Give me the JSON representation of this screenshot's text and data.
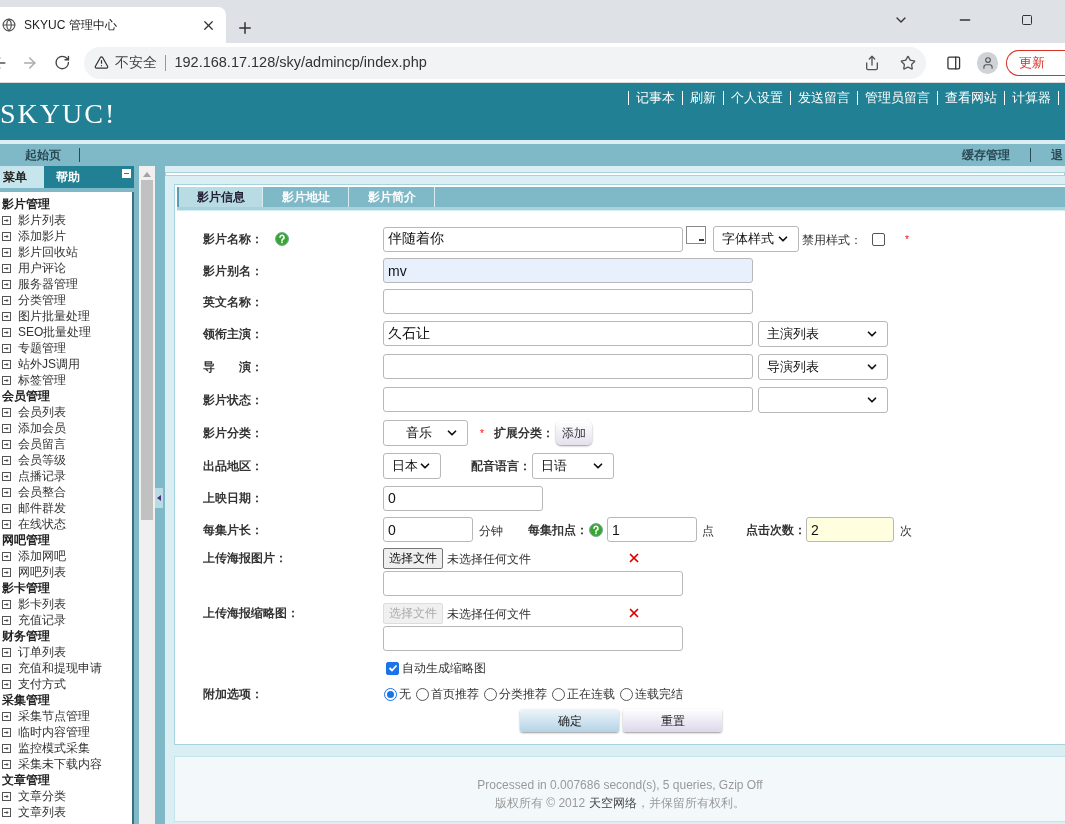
{
  "browser": {
    "tab_title": "SKYUC 管理中心",
    "security": "不安全",
    "url": "192.168.17.128/sky/admincp/index.php",
    "update_button": "更新"
  },
  "header": {
    "logo": "SKYUC!",
    "top_links": [
      "记事本",
      "刷新",
      "个人设置",
      "发送留言",
      "管理员留言",
      "查看网站",
      "计算器"
    ]
  },
  "subnav": {
    "left": [
      "起始页"
    ],
    "right": [
      "缓存管理",
      "退"
    ]
  },
  "sidebar": {
    "tabs": [
      {
        "label": "菜单",
        "selected": true
      },
      {
        "label": "帮助",
        "selected": false
      }
    ],
    "groups": [
      {
        "title": "影片管理",
        "items": [
          "影片列表",
          "添加影片",
          "影片回收站",
          "用户评论",
          "服务器管理",
          "分类管理",
          "图片批量处理",
          "SEO批量处理",
          "专题管理",
          "站外JS调用",
          "标签管理"
        ]
      },
      {
        "title": "会员管理",
        "items": [
          "会员列表",
          "添加会员",
          "会员留言",
          "会员等级",
          "点播记录",
          "会员整合",
          "邮件群发",
          "在线状态"
        ]
      },
      {
        "title": "网吧管理",
        "items": [
          "添加网吧",
          "网吧列表"
        ]
      },
      {
        "title": "影卡管理",
        "items": [
          "影卡列表",
          "充值记录"
        ]
      },
      {
        "title": "财务管理",
        "items": [
          "订单列表",
          "充值和提现申请",
          "支付方式"
        ]
      },
      {
        "title": "采集管理",
        "items": [
          "采集节点管理",
          "临时内容管理",
          "监控模式采集",
          "采集未下载内容"
        ]
      },
      {
        "title": "文章管理",
        "items": [
          "文章分类",
          "文章列表"
        ]
      }
    ]
  },
  "form": {
    "tabs": [
      {
        "label": "影片信息",
        "selected": true
      },
      {
        "label": "影片地址",
        "selected": false
      },
      {
        "label": "影片简介",
        "selected": false
      }
    ],
    "rows": [
      {
        "kind": "title",
        "label": "影片名称：",
        "value": "伴随着你",
        "style_select": "字体样式",
        "disable_label": "禁用样式：",
        "disable_checked": false,
        "required": "*"
      },
      {
        "kind": "text",
        "label": "影片别名：",
        "value": "mv",
        "autofilled": true
      },
      {
        "kind": "text",
        "label": "英文名称：",
        "autofilled": false
      },
      {
        "kind": "text_select",
        "label": "领衔主演：",
        "value": "久石让",
        "select": "主演列表"
      },
      {
        "kind": "text_select",
        "label": "导　　演：",
        "select": "导演列表"
      },
      {
        "kind": "text_select",
        "label": "影片状态："
      },
      {
        "kind": "category",
        "label": "影片分类：",
        "select": "音乐",
        "required": "*",
        "ext_label": "扩展分类：",
        "add_button": "添加"
      },
      {
        "kind": "region",
        "label": "出品地区：",
        "select": "日本",
        "lang_label": "配音语言：",
        "lang_select": "日语"
      },
      {
        "kind": "date",
        "label": "上映日期：",
        "value": "0"
      },
      {
        "kind": "length",
        "label": "每集片长：",
        "value": "0",
        "unit": "分钟",
        "points_label": "每集扣点：",
        "points_value": "1",
        "points_unit": "点",
        "clicks_label": "点击次数：",
        "clicks_value": "2",
        "clicks_unit": "次",
        "clicks_focused": true
      },
      {
        "kind": "file",
        "label": "上传海报图片：",
        "button": "选择文件",
        "disabled": false,
        "status": "未选择任何文件"
      },
      {
        "kind": "file",
        "label": "上传海报缩略图：",
        "button": "选择文件",
        "disabled": true,
        "status": "未选择任何文件"
      },
      {
        "kind": "checkbox",
        "text": "自动生成缩略图",
        "checked": true
      },
      {
        "kind": "radio",
        "label": "附加选项：",
        "options": [
          {
            "label": "无",
            "selected": true
          },
          {
            "label": "首页推荐",
            "selected": false
          },
          {
            "label": "分类推荐",
            "selected": false
          },
          {
            "label": "正在连载",
            "selected": false
          },
          {
            "label": "连载完结",
            "selected": false
          }
        ]
      }
    ],
    "buttons": [
      "确定",
      "重置"
    ]
  },
  "footer": {
    "processed": "Processed in 0.007686 second(s), 5 queries, Gzip Off",
    "copyright": "版权所有 © 2012",
    "company": "天空网络",
    "rights": "，并保留所有权利。"
  }
}
